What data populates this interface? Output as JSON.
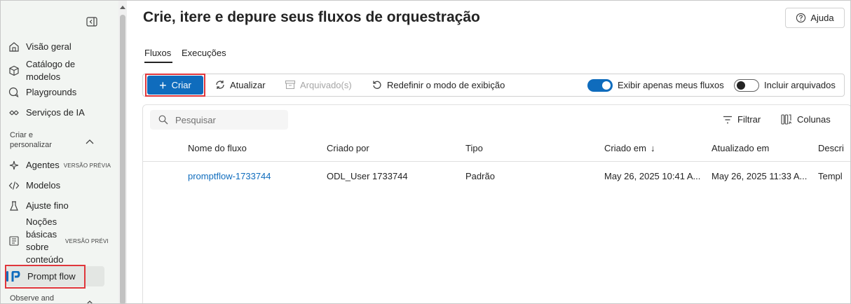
{
  "sidebar": {
    "items": [
      {
        "label": "Visão geral",
        "icon": "home-icon"
      },
      {
        "label": "Catálogo de modelos",
        "icon": "cube-icon"
      },
      {
        "label": "Playgrounds",
        "icon": "chat-icon"
      },
      {
        "label": "Serviços de IA",
        "icon": "link-icon"
      },
      {
        "label": "Agentes",
        "badge": "VERSÃO PRÉVIA",
        "icon": "agents-icon"
      },
      {
        "label": "Modelos",
        "icon": "code-icon"
      },
      {
        "label": "Ajuste fino",
        "icon": "flask-icon"
      },
      {
        "label": "Noções básicas sobre conteúdo",
        "badge": "VERSÃO PRÉVI",
        "icon": "document-icon"
      },
      {
        "label": "Prompt flow",
        "icon": "prompt-flow-icon"
      }
    ],
    "sections": [
      {
        "label": "Criar e personalizar"
      },
      {
        "label": "Observe and"
      }
    ]
  },
  "page": {
    "title": "Crie, itere e depure seus fluxos de orquestração",
    "help_label": "Ajuda"
  },
  "tabs": [
    {
      "label": "Fluxos",
      "active": true
    },
    {
      "label": "Execuções",
      "active": false
    }
  ],
  "toolbar": {
    "create_label": "Criar",
    "refresh_label": "Atualizar",
    "archived_label": "Arquivado(s)",
    "reset_view_label": "Redefinir o modo de exibição",
    "only_mine_label": "Exibir apenas meus fluxos",
    "only_mine_on": true,
    "include_archived_label": "Incluir arquivados",
    "include_archived_on": false
  },
  "table": {
    "search_placeholder": "Pesquisar",
    "filter_label": "Filtrar",
    "columns_label": "Colunas",
    "headers": [
      "Nome do fluxo",
      "Criado por",
      "Tipo",
      "Criado em",
      "Atualizado em",
      "Descri"
    ],
    "sort_arrow": "↓",
    "rows": [
      {
        "name": "promptflow-1733744",
        "created_by": "ODL_User 1733744",
        "type": "Padrão",
        "created_at": "May 26, 2025 10:41 A...",
        "updated_at": "May 26, 2025 11:33 A...",
        "description": "Templ"
      }
    ]
  },
  "colors": {
    "accent": "#0f6cbd",
    "highlight": "#e0363b",
    "sidebar_bg": "#f2f5f2"
  }
}
